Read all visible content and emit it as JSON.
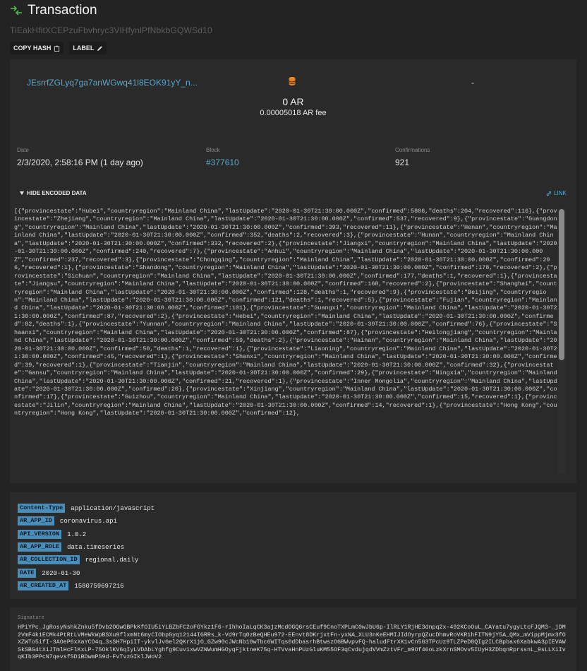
{
  "header": {
    "title": "Transaction",
    "tx_id": "TiEakHfitXCEPzuFbvhryc3VlHfynlPfNbkbGQWSd10",
    "copy_hash_label": "COPY HASH",
    "label_button": "LABEL"
  },
  "transfer": {
    "from": "JEsrrfZGLyq7ga7anWGwq41l8EOK91yY_n...",
    "to": "-",
    "amount": "0 AR",
    "fee": "0.00005018 AR fee"
  },
  "meta": {
    "date_label": "Date",
    "date_value": "2/3/2020, 2:58:16 PM (1 day ago)",
    "block_label": "Block",
    "block_value": "#377610",
    "confirmations_label": "Confirmations",
    "confirmations_value": "921"
  },
  "data_section": {
    "toggle_label": "HIDE ENCODED DATA",
    "link_label": "LINK",
    "content": "[{\"provincestate\":\"Hubei\",\"countryregion\":\"Mainland China\",\"lastUpdate\":\"2020-01-30T21:30:00.000Z\",\"confirmed\":5806,\"deaths\":204,\"recovered\":116},{\"provincestate\":\"Zhejiang\",\"countryregion\":\"Mainland China\",\"lastUpdate\":\"2020-01-30T21:30:00.000Z\",\"confirmed\":537,\"recovered\":9},{\"provincestate\":\"Guangdong\",\"countryregion\":\"Mainland China\",\"lastUpdate\":\"2020-01-30T21:30:00.000Z\",\"confirmed\":393,\"recovered\":11},{\"provincestate\":\"Henan\",\"countryregion\":\"Mainland China\",\"lastUpdate\":\"2020-01-30T21:30:00.000Z\",\"confirmed\":352,\"deaths\":2,\"recovered\":3},{\"provincestate\":\"Hunan\",\"countryregion\":\"Mainland China\",\"lastUpdate\":\"2020-01-30T21:30:00.000Z\",\"confirmed\":332,\"recovered\":2},{\"provincestate\":\"Jiangxi\",\"countryregion\":\"Mainland China\",\"lastUpdate\":\"2020-01-30T21:30:00.000Z\",\"confirmed\":240,\"recovered\":7},{\"provincestate\":\"Anhui\",\"countryregion\":\"Mainland China\",\"lastUpdate\":\"2020-01-30T21:30:00.000Z\",\"confirmed\":237,\"recovered\":3},{\"provincestate\":\"Chongqing\",\"countryregion\":\"Mainland China\",\"lastUpdate\":\"2020-01-30T21:30:00.000Z\",\"confirmed\":206,\"recovered\":1},{\"provincestate\":\"Shandong\",\"countryregion\":\"Mainland China\",\"lastUpdate\":\"2020-01-30T21:30:00.000Z\",\"confirmed\":178,\"recovered\":2},{\"provincestate\":\"Sichuan\",\"countryregion\":\"Mainland China\",\"lastUpdate\":\"2020-01-30T21:30:00.000Z\",\"confirmed\":177,\"deaths\":1,\"recovered\":1},{\"provincestate\":\"Jiangsu\",\"countryregion\":\"Mainland China\",\"lastUpdate\":\"2020-01-30T21:30:00.000Z\",\"confirmed\":168,\"recovered\":2},{\"provincestate\":\"Shanghai\",\"countryregion\":\"Mainland China\",\"lastUpdate\":\"2020-01-30T21:30:00.000Z\",\"confirmed\":128,\"deaths\":1,\"recovered\":9},{\"provincestate\":\"Beijing\",\"countryregion\":\"Mainland China\",\"lastUpdate\":\"2020-01-30T21:30:00.000Z\",\"confirmed\":121,\"deaths\":1,\"recovered\":5},{\"provincestate\":\"Fujian\",\"countryregion\":\"Mainland China\",\"lastUpdate\":\"2020-01-30T21:30:00.000Z\",\"confirmed\":101},{\"provincestate\":\"Guangxi\",\"countryregion\":\"Mainland China\",\"lastUpdate\":\"2020-01-30T21:30:00.000Z\",\"confirmed\":87,\"recovered\":2},{\"provincestate\":\"Hebei\",\"countryregion\":\"Mainland China\",\"lastUpdate\":\"2020-01-30T21:30:00.000Z\",\"confirmed\":82,\"deaths\":1},{\"provincestate\":\"Yunnan\",\"countryregion\":\"Mainland China\",\"lastUpdate\":\"2020-01-30T21:30:00.000Z\",\"confirmed\":76},{\"provincestate\":\"Shaanxi\",\"countryregion\":\"Mainland China\",\"lastUpdate\":\"2020-01-30T21:30:00.000Z\",\"confirmed\":87},{\"provincestate\":\"Heilongjiang\",\"countryregion\":\"Mainland China\",\"lastUpdate\":\"2020-01-30T21:30:00.000Z\",\"confirmed\":59,\"deaths\":2},{\"provincestate\":\"Hainan\",\"countryregion\":\"Mainland China\",\"lastUpdate\":\"2020-01-30T21:30:00.000Z\",\"confirmed\":50,\"deaths\":1,\"recovered\":1},{\"provincestate\":\"Liaoning\",\"countryregion\":\"Mainland China\",\"lastUpdate\":\"2020-01-30T21:30:00.000Z\",\"confirmed\":45,\"recovered\":1},{\"provincestate\":\"Shanxi\",\"countryregion\":\"Mainland China\",\"lastUpdate\":\"2020-01-30T21:30:00.000Z\",\"confirmed\":39,\"recovered\":1},{\"provincestate\":\"Tianjin\",\"countryregion\":\"Mainland China\",\"lastUpdate\":\"2020-01-30T21:30:00.000Z\",\"confirmed\":32},{\"provincestate\":\"Gansu\",\"countryregion\":\"Mainland China\",\"lastUpdate\":\"2020-01-30T21:30:00.000Z\",\"confirmed\":29},{\"provincestate\":\"Ningxia\",\"countryregion\":\"Mainland China\",\"lastUpdate\":\"2020-01-30T21:30:00.000Z\",\"confirmed\":21,\"recovered\":1},{\"provincestate\":\"Inner Mongolia\",\"countryregion\":\"Mainland China\",\"lastUpdate\":\"2020-01-30T21:30:00.000Z\",\"confirmed\":20},{\"provincestate\":\"Xinjiang\",\"countryregion\":\"Mainland China\",\"lastUpdate\":\"2020-01-30T21:30:00.000Z\",\"confirmed\":17},{\"provincestate\":\"Guizhou\",\"countryregion\":\"Mainland China\",\"lastUpdate\":\"2020-01-30T21:30:00.000Z\",\"confirmed\":15,\"recovered\":1},{\"provincestate\":\"Jilin\",\"countryregion\":\"Mainland China\",\"lastUpdate\":\"2020-01-30T21:30:00.000Z\",\"confirmed\":14,\"recovered\":1},{\"provincestate\":\"Hong Kong\",\"countryregion\":\"Hong Kong\",\"lastUpdate\":\"2020-01-30T21:30:00.000Z\",\"confirmed\":12},"
  },
  "tags": [
    {
      "key": "Content-Type",
      "value": "application/javascript"
    },
    {
      "key": "AR_APP_ID",
      "value": "coronavirus.api"
    },
    {
      "key": "API_VERSION",
      "value": "1.0.2"
    },
    {
      "key": "AR_APP_ROLE",
      "value": "data.timeseries"
    },
    {
      "key": "AR_COLLECTION_ID",
      "value": "regional.daily"
    },
    {
      "key": "DATE",
      "value": "2020-01-30"
    },
    {
      "key": "AR_CREATED_AT",
      "value": "1580759697216"
    }
  ],
  "signature": {
    "label": "Signature",
    "value": "HPiYPc_JgRosyNshkZnku5fDvb2OGwGBPkKfOIU5iYLBZbFC2oFGYkz1F6-rIhhoIaLqCK3ajzMcdOGQ6rsCEuf9CnoTXPLmC0wJbU6p-IlRLY1RjHE3dnpq2x-492KCoOuL_CAYatu7ygyLtcFJQM3-_jDM2VmF4k1ECMk4PtRtLVMeWkWpBSXu9flxmNt6myCIObpGyq12144IGRRs_k-Vd9rTq0zBeQHEu972-EEnvt8DKrjxtFn-yxNA_XLU3nKeEHMIJIdOyrpQZucDhmvRoVKR1hFITN9jY5A_QMx_mVippMjmx3fOXZWTo5ifI-3AOeP6xXaYCO4q_3sSH7HpiIT-ykvlJvGel2QKrX1jO_GZw90cJWcNb10wTbc6WITqs0dDbasrhBtwszOGBWvpvFQ-haludFtrXK1vCn5G3TPcUz9TLZPeD8QIg2ILCBpbax6XabkwA3pIEVAWSkSBG4tXiJTmlHcFlKxLP-75OklKV6qIyLVDAbLYghfg9Cuv1xwVZNWumHGOyqFjktneK75q-HTVvaHnPUzGluKM55OF3qCvdujqdVVmZztVFr_m9Of46oLzkXrnSMOvv5IUyH3ZDbqnRprssnL_9sLLXiIvqKIb3PPcN7qevsfSDiBDwmPS9d-FvTvzGIklJWoV2"
  }
}
